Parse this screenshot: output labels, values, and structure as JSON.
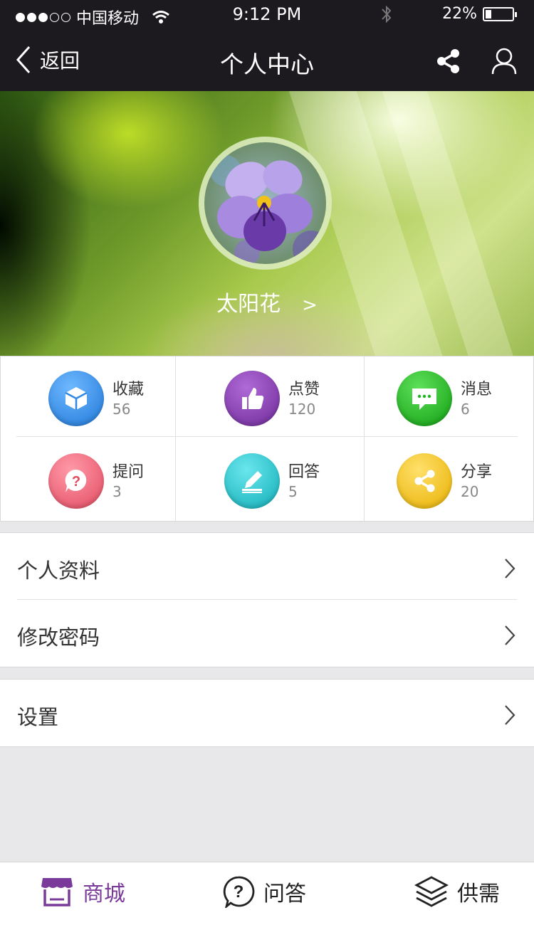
{
  "status_bar": {
    "carrier": "中国移动",
    "time": "9:12 PM",
    "battery_percent": "22%",
    "battery_level": 0.22
  },
  "nav": {
    "back_label": "返回",
    "title": "个人中心"
  },
  "profile": {
    "username": "太阳花",
    "chevron": ">"
  },
  "stats": [
    {
      "label": "收藏",
      "count": "56",
      "icon": "cube-icon",
      "color": "#2f88e6"
    },
    {
      "label": "点赞",
      "count": "120",
      "icon": "thumbs-up-icon",
      "color": "#8a3cb4"
    },
    {
      "label": "消息",
      "count": "6",
      "icon": "message-icon",
      "color": "#1fb61f"
    },
    {
      "label": "提问",
      "count": "3",
      "icon": "question-icon",
      "color": "#f06478"
    },
    {
      "label": "回答",
      "count": "5",
      "icon": "edit-icon",
      "color": "#19c4cc"
    },
    {
      "label": "分享",
      "count": "20",
      "icon": "share-icon",
      "color": "#f2c318"
    }
  ],
  "menu": {
    "profile": "个人资料",
    "password": "修改密码",
    "settings": "设置"
  },
  "tabs": [
    {
      "label": "商城",
      "icon": "store-icon",
      "active": true
    },
    {
      "label": "问答",
      "icon": "question-icon",
      "active": false
    },
    {
      "label": "供需",
      "icon": "layers-icon",
      "active": false
    }
  ],
  "colors": {
    "active_tab": "#7a3a9a",
    "header_bg": "#1c1a1f"
  }
}
